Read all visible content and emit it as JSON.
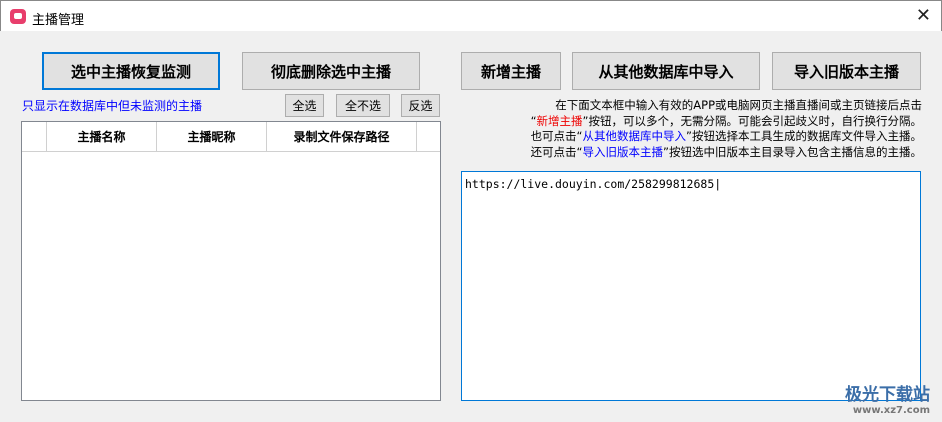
{
  "window": {
    "title": "主播管理",
    "close": "✕"
  },
  "buttons": {
    "restore": "选中主播恢复监测",
    "delete": "彻底删除选中主播",
    "add": "新增主播",
    "import_db": "从其他数据库中导入",
    "import_old": "导入旧版本主播"
  },
  "filter_link": "只显示在数据库中但未监测的主播",
  "select": {
    "all": "全选",
    "none": "全不选",
    "invert": "反选"
  },
  "table": {
    "columns": [
      "",
      "主播名称",
      "主播昵称",
      "录制文件保存路径",
      ""
    ],
    "rows": []
  },
  "hint": {
    "l1": "在下面文本框中输入有效的APP或电脑网页主播直播间或主页链接后点击",
    "l2a": "“",
    "l2b": "新增主播",
    "l2c": "”按钮，可以多个，无需分隔。可能会引起歧义时，自行换行分隔。",
    "l3a": "也可点击“",
    "l3b": "从其他数据库中导入",
    "l3c": "”按钮选择本工具生成的数据库文件导入主播。",
    "l4a": "还可点击“",
    "l4b": "导入旧版本主播",
    "l4c": "”按钮选中旧版本主目录导入包含主播信息的主播。"
  },
  "input": {
    "value": "https://live.douyin.com/258299812685"
  },
  "watermark": {
    "name": "极光下载站",
    "url": "www.xz7.com"
  }
}
